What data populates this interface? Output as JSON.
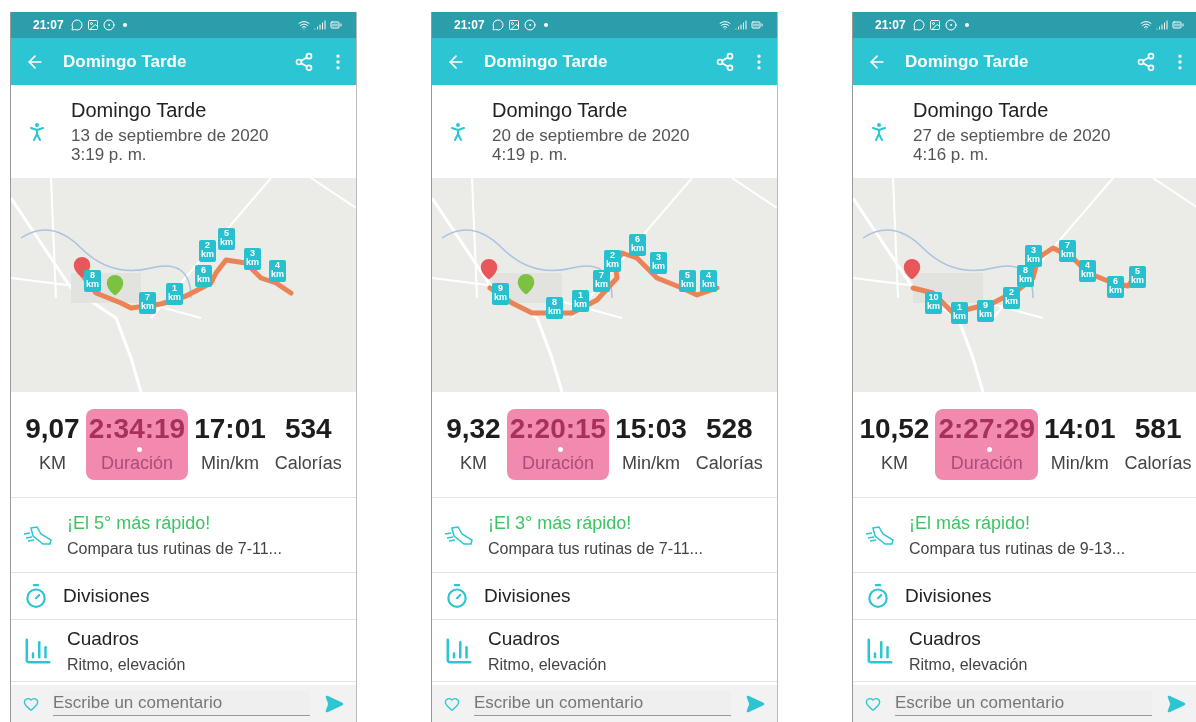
{
  "screens": [
    {
      "status_bar": {
        "time": "21:07"
      },
      "app_bar": {
        "title": "Domingo Tarde"
      },
      "activity": {
        "name": "Domingo Tarde",
        "date": "13 de septiembre de 2020",
        "time": "3:19 p. m."
      },
      "map": {
        "kind": "picture",
        "pins": [
          {
            "color": "#e8575a"
          },
          {
            "color": "#7cc242"
          }
        ],
        "markers": [
          {
            "number": "8",
            "unit": "km"
          },
          {
            "number": "7",
            "unit": "km"
          },
          {
            "number": "1",
            "unit": "km"
          },
          {
            "number": "6",
            "unit": "km"
          },
          {
            "number": "2",
            "unit": "km"
          },
          {
            "number": "5",
            "unit": "km"
          },
          {
            "number": "3",
            "unit": "km"
          },
          {
            "number": "4",
            "unit": "km"
          }
        ]
      },
      "stats": [
        {
          "value": "9,07",
          "label": "KM",
          "pressed": false
        },
        {
          "value": "2:34:19",
          "label": "Duración",
          "pressed": true
        },
        {
          "value": "17:01",
          "label": "Min/km",
          "pressed": false
        },
        {
          "value": "534",
          "label": "Calorías",
          "pressed": false
        }
      ],
      "ranking": {
        "title": "¡El 5° más rápido!",
        "subtitle": "Compara tus rutinas de 7-11..."
      },
      "rows": [
        {
          "kind": "splits",
          "title": "Divisiones"
        },
        {
          "kind": "charts",
          "title": "Cuadros",
          "subtitle": "Ritmo, elevación"
        }
      ],
      "comment": {
        "placeholder": "Escribe un comentario"
      }
    },
    {
      "status_bar": {
        "time": "21:07"
      },
      "app_bar": {
        "title": "Domingo Tarde"
      },
      "activity": {
        "name": "Domingo Tarde",
        "date": "20 de septiembre de 2020",
        "time": "4:19 p. m."
      },
      "map": {
        "kind": "picture",
        "pins": [
          {
            "color": "#e8575a"
          },
          {
            "color": "#7cc242"
          }
        ],
        "markers": [
          {
            "number": "9",
            "unit": "km"
          },
          {
            "number": "8",
            "unit": "km"
          },
          {
            "number": "1",
            "unit": "km"
          },
          {
            "number": "7",
            "unit": "km"
          },
          {
            "number": "2",
            "unit": "km"
          },
          {
            "number": "6",
            "unit": "km"
          },
          {
            "number": "3",
            "unit": "km"
          },
          {
            "number": "5",
            "unit": "km"
          },
          {
            "number": "4",
            "unit": "km"
          }
        ]
      },
      "stats": [
        {
          "value": "9,32",
          "label": "KM",
          "pressed": false
        },
        {
          "value": "2:20:15",
          "label": "Duración",
          "pressed": true
        },
        {
          "value": "15:03",
          "label": "Min/km",
          "pressed": false
        },
        {
          "value": "528",
          "label": "Calorías",
          "pressed": false
        }
      ],
      "ranking": {
        "title": "¡El 3° más rápido!",
        "subtitle": "Compara tus rutinas de 7-11..."
      },
      "rows": [
        {
          "kind": "splits",
          "title": "Divisiones"
        },
        {
          "kind": "charts",
          "title": "Cuadros",
          "subtitle": "Ritmo, elevación"
        }
      ],
      "comment": {
        "placeholder": "Escribe un comentario"
      }
    },
    {
      "status_bar": {
        "time": "21:07"
      },
      "app_bar": {
        "title": "Domingo Tarde"
      },
      "activity": {
        "name": "Domingo Tarde",
        "date": "27 de septiembre de 2020",
        "time": "4:16 p. m."
      },
      "map": {
        "kind": "picture",
        "pins": [
          {
            "color": "#e8575a"
          }
        ],
        "markers": [
          {
            "number": "10",
            "unit": "km"
          },
          {
            "number": "1",
            "unit": "km"
          },
          {
            "number": "9",
            "unit": "km"
          },
          {
            "number": "2",
            "unit": "km"
          },
          {
            "number": "8",
            "unit": "km"
          },
          {
            "number": "3",
            "unit": "km"
          },
          {
            "number": "7",
            "unit": "km"
          },
          {
            "number": "4",
            "unit": "km"
          },
          {
            "number": "6",
            "unit": "km"
          },
          {
            "number": "5",
            "unit": "km"
          }
        ]
      },
      "stats": [
        {
          "value": "10,52",
          "label": "KM",
          "pressed": false
        },
        {
          "value": "2:27:29",
          "label": "Duración",
          "pressed": true
        },
        {
          "value": "14:01",
          "label": "Min/km",
          "pressed": false
        },
        {
          "value": "581",
          "label": "Calorías",
          "pressed": false
        }
      ],
      "ranking": {
        "title": "¡El más rápido!",
        "subtitle": "Compara tus rutinas de 9-13..."
      },
      "rows": [
        {
          "kind": "splits",
          "title": "Divisiones"
        },
        {
          "kind": "charts",
          "title": "Cuadros",
          "subtitle": "Ritmo, elevación"
        }
      ],
      "comment": {
        "placeholder": "Escribe un comentario"
      }
    }
  ]
}
